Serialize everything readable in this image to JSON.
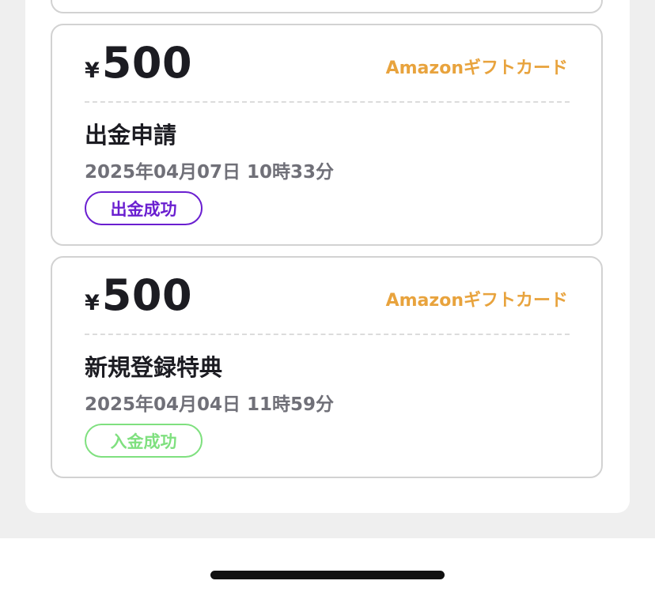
{
  "transactions": [
    {
      "currency_symbol": "¥",
      "amount": "500",
      "method": "Amazonギフトカード",
      "title": "出金申請",
      "datetime": "2025年04月07日 10時33分",
      "status": "出金成功",
      "status_color": "#6a1fd0"
    },
    {
      "currency_symbol": "¥",
      "amount": "500",
      "method": "Amazonギフトカード",
      "title": "新規登録特典",
      "datetime": "2025年04月04日 11時59分",
      "status": "入金成功",
      "status_color": "#7fe07f"
    }
  ],
  "colors": {
    "accent_method": "#e8a33d",
    "text_primary": "#1c1c22",
    "text_secondary": "#707078"
  }
}
